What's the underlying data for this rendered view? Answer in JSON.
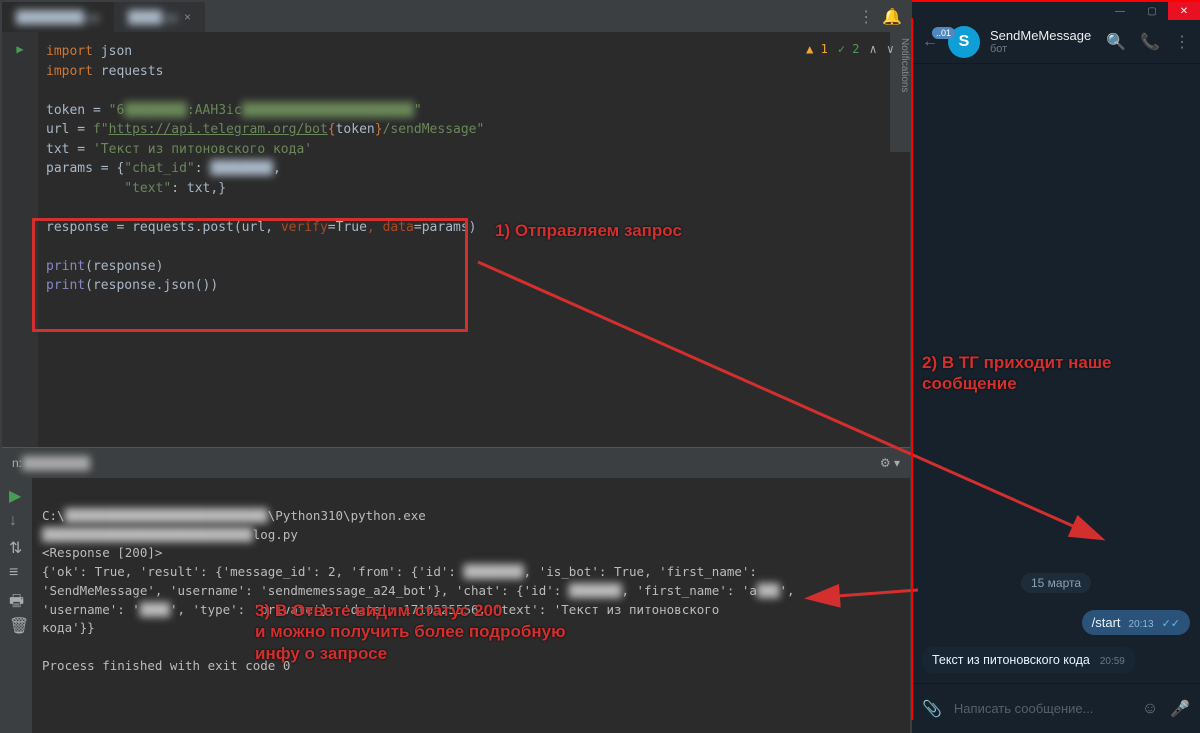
{
  "ide": {
    "inspections": {
      "warn": "1",
      "ok": "2"
    },
    "notifications_label": "Notifications",
    "code": {
      "l1_import": "import",
      "l1_json": " json",
      "l2_import": "import",
      "l2_req": " requests",
      "l4_token": "token = ",
      "l4_str1": "\"6",
      "l4_blur": "████████",
      "l4_str2": ":AAH3ic",
      "l4_blur2": "██████████████████████",
      "l4_str3": "\"",
      "l5_url": "url = ",
      "l5_f": "f\"",
      "l5_link": "https://api.telegram.org/bot",
      "l5_brace1": "{",
      "l5_tok": "token",
      "l5_brace2": "}",
      "l5_send": "/sendMessage",
      "l5_end": "\"",
      "l6_txt": "txt = ",
      "l6_str": "'Текст из питоновского кода'",
      "l7_params": "params = {",
      "l7_key": "\"chat_id\"",
      "l7_colon": ": ",
      "l7_blur": "████████",
      "l7_comma": ",",
      "l8_key": "\"text\"",
      "l8_colon": ": txt,}",
      "l10": "response = requests.post(url, ",
      "l10_verify": "verify",
      "l10_true": "=True",
      "l10_data": ", data",
      "l10_params": "=params)",
      "l12_print": "print",
      "l12_arg": "(response)",
      "l13_print": "print",
      "l13_arg": "(response.json())"
    },
    "run_label": "n:",
    "output": {
      "path1_pref": "C:\\",
      "path1_blur": "███████████████████████████",
      "path1_suf": "\\Python310\\python.exe",
      "path2_pref": "",
      "path2_blur": "████████████████████████████",
      "path2_suf": "log.py",
      "resp": "<Response [200]>",
      "json_l1": "{'ok': True, 'result': {'message_id': 2, 'from': {'id': ",
      "json_blur1": "████████",
      "json_l2": ", 'is_bot': True, 'first_name':",
      "json_l3": "'SendMeMessage', 'username': 'sendmemessage_a24_bot'}, 'chat': {'id': ",
      "json_blur2": "███████",
      "json_l4": ", 'first_name': 'a",
      "json_blur3": "███",
      "json_l5": "',",
      "json_l6": "'username': '",
      "json_blur4": "████",
      "json_l7": "', 'type': 'private'}, 'date': 1710525556, 'text': 'Текст из питоновского",
      "json_l8": "кода'}}",
      "finished": "Process finished with exit code 0"
    }
  },
  "telegram": {
    "back_badge": "..01",
    "avatar_letter": "S",
    "bot_name": "SendMeMessage",
    "bot_sub": "бот",
    "date": "15 марта",
    "msg_start": "/start",
    "msg_start_time": "20:13",
    "msg_in": "Текст из питоновского кода",
    "msg_in_time": "20:59",
    "input_placeholder": "Написать сообщение..."
  },
  "annotations": {
    "a1": "1) Отправляем запрос",
    "a2": "2) В ТГ приходит наше сообщение",
    "a3_l1": "3) В Ответе видим статус 200",
    "a3_l2": "и можно получить более подробную",
    "a3_l3": "инфу о запросе"
  }
}
